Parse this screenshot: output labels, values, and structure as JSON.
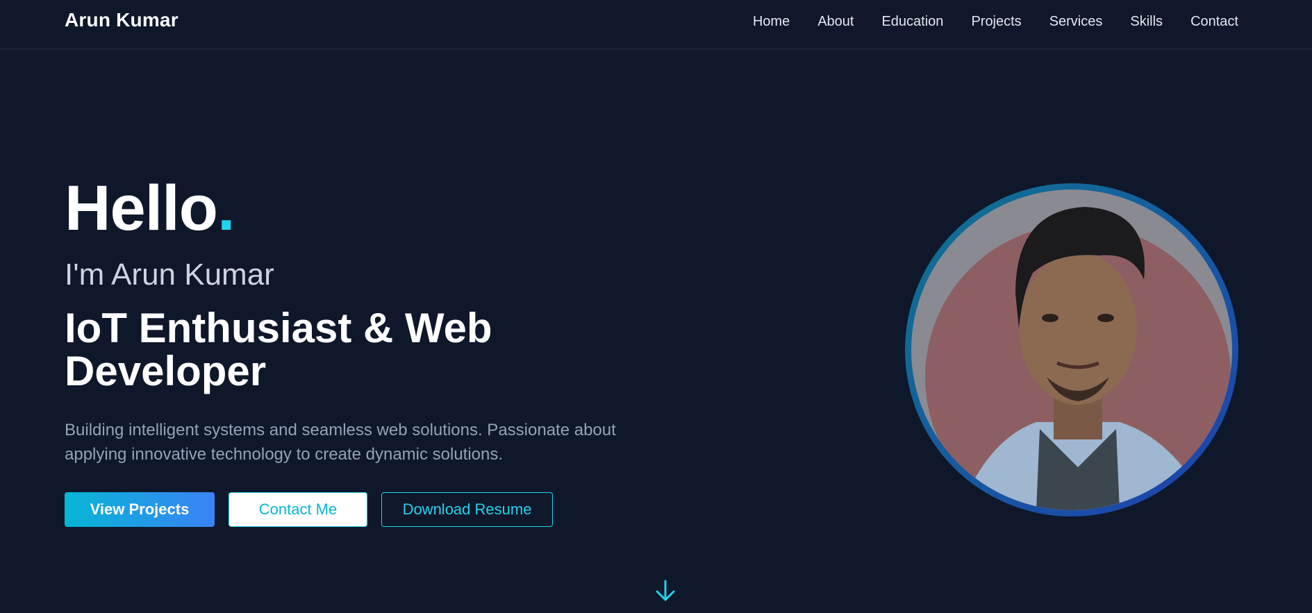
{
  "nav": {
    "brand": "Arun Kumar",
    "links": [
      "Home",
      "About",
      "Education",
      "Projects",
      "Services",
      "Skills",
      "Contact"
    ]
  },
  "hero": {
    "greeting": "Hello",
    "greeting_dot": ".",
    "intro": "I'm Arun Kumar",
    "role": "IoT Enthusiast & Web Developer",
    "description": "Building intelligent systems and seamless web solutions. Passionate about applying innovative technology to create dynamic solutions.",
    "buttons": {
      "view_projects": "View Projects",
      "contact": "Contact Me",
      "resume": "Download Resume"
    }
  },
  "colors": {
    "background": "#0f172a",
    "accent": "#22d3ee",
    "accent_blue": "#3b82f6"
  },
  "icons": {
    "scroll": "arrow-down-icon",
    "avatar": "profile-photo"
  }
}
